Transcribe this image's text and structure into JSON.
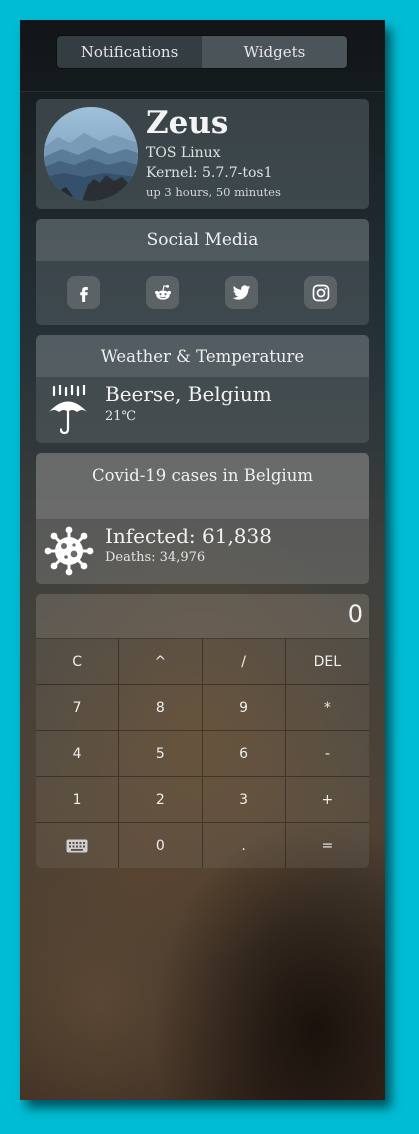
{
  "tabs": {
    "notifications": "Notifications",
    "widgets": "Widgets"
  },
  "profile": {
    "name": "Zeus",
    "os": "TOS Linux",
    "kernel": "Kernel: 5.7.7-tos1",
    "uptime": "up 3 hours, 50 minutes"
  },
  "social": {
    "title": "Social Media",
    "icons": [
      "facebook-icon",
      "reddit-icon",
      "twitter-icon",
      "instagram-icon"
    ]
  },
  "weather": {
    "title": "Weather & Temperature",
    "location": "Beerse, Belgium",
    "temperature": "21℃",
    "icon": "umbrella-rain-icon"
  },
  "covid": {
    "title": "Covid-19 cases in Belgium",
    "infected": "Infected: 61,838",
    "deaths": "Deaths: 34,976",
    "icon": "virus-icon"
  },
  "calculator": {
    "display": "0",
    "keys": [
      "C",
      "^",
      "/",
      "DEL",
      "7",
      "8",
      "9",
      "*",
      "4",
      "5",
      "6",
      "-",
      "1",
      "2",
      "3",
      "+",
      "keyboard",
      "0",
      ".",
      "="
    ]
  }
}
